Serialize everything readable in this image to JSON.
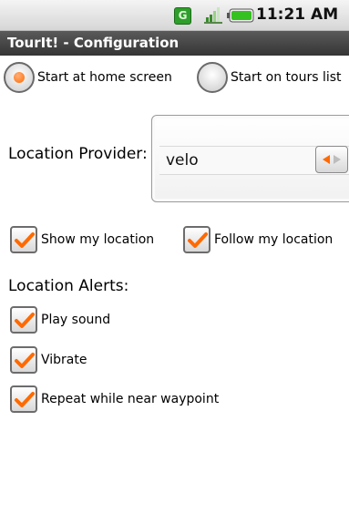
{
  "status_bar": {
    "notification_icon": "G",
    "signal_icon": "signal-icon",
    "battery_icon": "battery-icon",
    "time": "11:21 AM"
  },
  "title": "TourIt! - Configuration",
  "start_options": [
    {
      "label": "Start at home screen",
      "selected": true
    },
    {
      "label": "Start on tours list",
      "selected": false
    }
  ],
  "location_provider": {
    "label": "Location Provider:",
    "value": "velo"
  },
  "map_options": [
    {
      "label": "Show my location",
      "checked": true
    },
    {
      "label": "Follow my location",
      "checked": true
    }
  ],
  "alerts": {
    "label": "Location Alerts:",
    "items": [
      {
        "label": "Play sound",
        "checked": true
      },
      {
        "label": "Vibrate",
        "checked": true
      },
      {
        "label": "Repeat while near waypoint",
        "checked": true
      }
    ]
  },
  "colors": {
    "accent": "#ff6a00",
    "titlebar": "#3c3c3c",
    "notification_green": "#2e9f2a"
  }
}
